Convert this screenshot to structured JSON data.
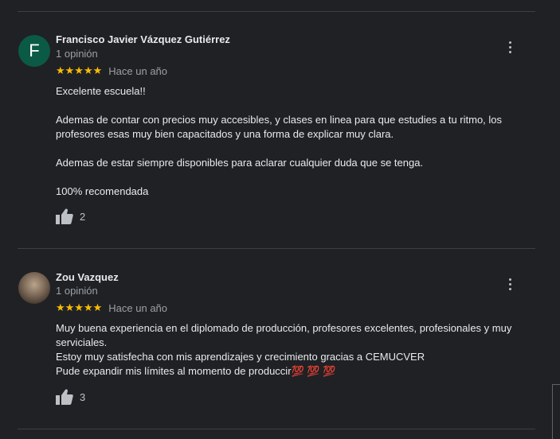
{
  "reviews": [
    {
      "author": "Francisco Javier Vázquez Gutiérrez",
      "avatar_letter": "F",
      "review_count": "1 opinión",
      "stars": "★★★★★",
      "rating": 5,
      "time": "Hace un año",
      "paragraphs": [
        "Excelente escuela!!",
        "Ademas de contar con precios muy accesibles, y clases en linea para que estudies a tu ritmo, los profesores esas muy bien capacitados y una forma de explicar muy clara.",
        "Ademas de estar siempre disponibles para aclarar cualquier duda que se tenga.",
        "100% recomendada"
      ],
      "likes": "2"
    },
    {
      "author": "Zou Vazquez",
      "review_count": "1 opinión",
      "stars": "★★★★★",
      "rating": 5,
      "time": "Hace un año",
      "lines": [
        "Muy buena experiencia en el diplomado de producción, profesores excelentes, profesionales y muy serviciales.",
        "Estoy muy satisfecha con mis aprendizajes y crecimiento gracias a CEMUCVER",
        "Pude expandir mis límites al momento de produccir💯 💯 💯"
      ],
      "likes": "3"
    }
  ],
  "icons": {
    "more": "more-vert-icon",
    "like": "thumb-up-icon",
    "star": "star-icon"
  },
  "colors": {
    "background": "#202124",
    "star": "#fbbc04",
    "avatar_letter_bg": "#0b5a45",
    "divider": "#3c4043"
  }
}
